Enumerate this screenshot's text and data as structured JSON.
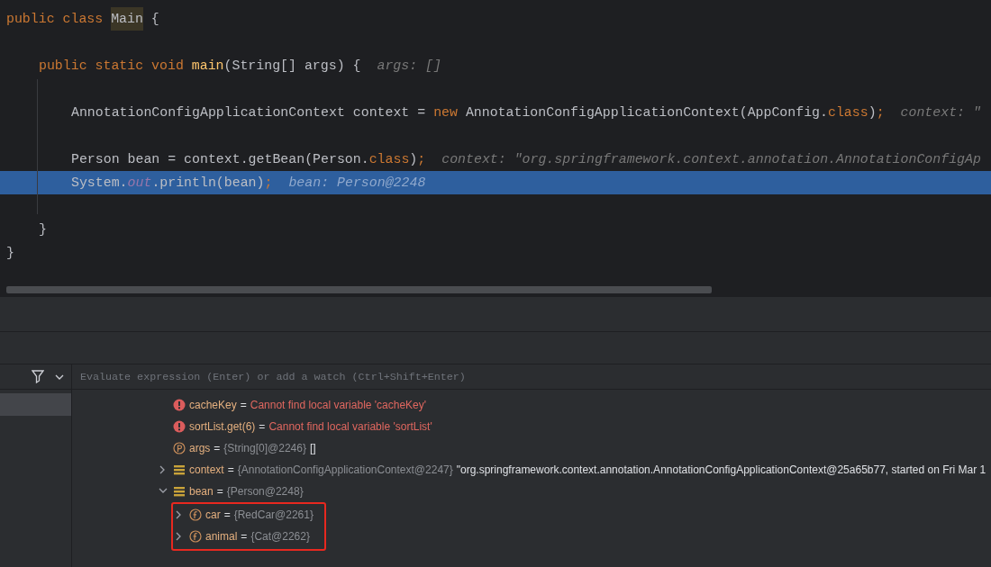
{
  "editor": {
    "lines": [
      {
        "selected": false,
        "tokens": [
          {
            "kind": "keyword",
            "text": "public class "
          },
          {
            "kind": "usage-highlight",
            "text": "Main"
          },
          {
            "kind": "plain",
            "text": " {"
          }
        ]
      },
      {
        "selected": false
      },
      {
        "selected": false,
        "tokens": [
          {
            "kind": "keyword",
            "text": "public static void "
          },
          {
            "kind": "method",
            "text": "main"
          },
          {
            "kind": "plain",
            "text": "(String[] args) {"
          },
          {
            "kind": "hint",
            "text": "args: []"
          }
        ]
      },
      {
        "selected": false
      },
      {
        "selected": false,
        "tokens": [
          {
            "kind": "plain",
            "text": "AnnotationConfigApplicationContext context = "
          },
          {
            "kind": "keyword",
            "text": "new "
          },
          {
            "kind": "plain",
            "text": "AnnotationConfigApplicationContext(AppConfig."
          },
          {
            "kind": "keyword",
            "text": "class"
          },
          {
            "kind": "plain",
            "text": ")"
          },
          {
            "kind": "keyword",
            "text": ";"
          },
          {
            "kind": "hint",
            "text": "context: \""
          }
        ]
      },
      {
        "selected": false
      },
      {
        "selected": false,
        "tokens": [
          {
            "kind": "plain",
            "text": "Person bean = context.getBean(Person."
          },
          {
            "kind": "keyword",
            "text": "class"
          },
          {
            "kind": "plain",
            "text": ")"
          },
          {
            "kind": "keyword",
            "text": ";"
          },
          {
            "kind": "hint",
            "text": "context: \"org.springframework.context.annotation.AnnotationConfigAp"
          }
        ]
      },
      {
        "selected": true,
        "tokens": [
          {
            "kind": "plain",
            "text": "System."
          },
          {
            "kind": "static-field",
            "text": "out"
          },
          {
            "kind": "plain",
            "text": ".println(bean)"
          },
          {
            "kind": "keyword",
            "text": ";"
          },
          {
            "kind": "hint",
            "text": "bean: Person@2248"
          }
        ]
      },
      {
        "selected": false
      },
      {
        "selected": false,
        "tokens": [
          {
            "kind": "plain",
            "text": "}"
          }
        ]
      },
      {
        "selected": false,
        "tokens": [
          {
            "kind": "plain",
            "text": "}"
          }
        ]
      }
    ]
  },
  "debugger": {
    "evaluate_field": {
      "placeholder": "Evaluate expression (Enter) or add a watch (Ctrl+Shift+Enter)"
    },
    "variables": [
      {
        "kind": "error",
        "name": "cacheKey",
        "operator": "=",
        "message": "Cannot find local variable 'cacheKey'"
      },
      {
        "kind": "error",
        "name": "sortList.get(6)",
        "operator": "=",
        "message": "Cannot find local variable 'sortList'"
      },
      {
        "kind": "parameter",
        "name": "args",
        "operator": "=",
        "type": "{String[0]@2246}",
        "value": "[]"
      },
      {
        "kind": "local",
        "name": "context",
        "operator": "=",
        "type": "{AnnotationConfigApplicationContext@2247}",
        "value": "\"org.springframework.context.annotation.AnnotationConfigApplicationContext@25a65b77, started on Fri Mar 1",
        "expanded": false
      },
      {
        "kind": "local",
        "name": "bean",
        "operator": "=",
        "type": "{Person@2248}",
        "expanded": true,
        "children_marked": true,
        "children": [
          {
            "kind": "field",
            "name": "car",
            "operator": "=",
            "type": "{RedCar@2261}",
            "expanded": false
          },
          {
            "kind": "field",
            "name": "animal",
            "operator": "=",
            "type": "{Cat@2262}",
            "expanded": false
          }
        ]
      }
    ]
  }
}
